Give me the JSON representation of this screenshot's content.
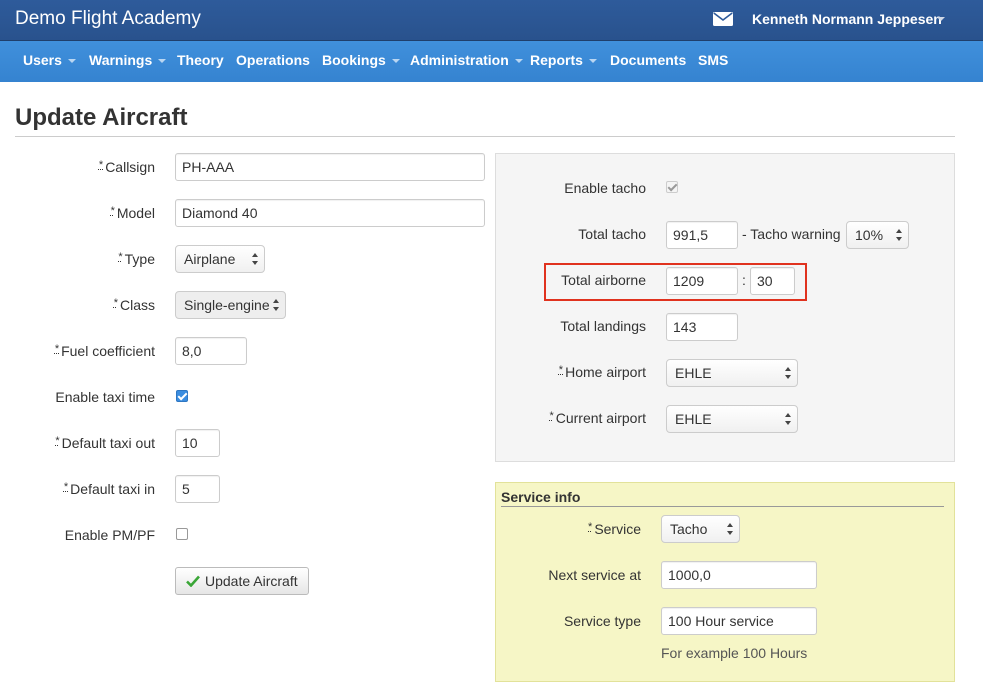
{
  "header": {
    "brand": "Demo Flight Academy",
    "user_name": "Kenneth Normann Jeppesen"
  },
  "nav": [
    {
      "label": "Users",
      "dropdown": true
    },
    {
      "label": "Warnings",
      "dropdown": true
    },
    {
      "label": "Theory",
      "dropdown": false
    },
    {
      "label": "Operations",
      "dropdown": false
    },
    {
      "label": "Bookings",
      "dropdown": true
    },
    {
      "label": "Administration",
      "dropdown": true
    },
    {
      "label": "Reports",
      "dropdown": true
    },
    {
      "label": "Documents",
      "dropdown": false
    },
    {
      "label": "SMS",
      "dropdown": false
    }
  ],
  "page_title": "Update Aircraft",
  "required_mark": "*",
  "left_form": {
    "callsign_label": "Callsign",
    "callsign_value": "PH-AAA",
    "model_label": "Model",
    "model_value": "Diamond 40",
    "type_label": "Type",
    "type_value": "Airplane",
    "class_label": "Class",
    "class_value": "Single-engine",
    "fuel_label": "Fuel coefficient",
    "fuel_value": "8,0",
    "taxi_time_label": "Enable taxi time",
    "taxi_time_checked": true,
    "taxi_out_label": "Default taxi out",
    "taxi_out_value": "10",
    "taxi_in_label": "Default taxi in",
    "taxi_in_value": "5",
    "pmpf_label": "Enable PM/PF",
    "pmpf_checked": false,
    "submit_label": "Update Aircraft"
  },
  "right_form": {
    "enable_tacho_label": "Enable tacho",
    "enable_tacho_checked": true,
    "total_tacho_label": "Total tacho",
    "total_tacho_value": "991,5",
    "tacho_warning_label": "- Tacho warning",
    "tacho_warning_value": "10%",
    "total_airborne_label": "Total airborne",
    "airborne_hours": "1209",
    "airborne_separator": ":",
    "airborne_minutes": "30",
    "total_landings_label": "Total landings",
    "total_landings_value": "143",
    "home_airport_label": "Home airport",
    "home_airport_value": "EHLE",
    "current_airport_label": "Current airport",
    "current_airport_value": "EHLE"
  },
  "service_info": {
    "title": "Service info",
    "service_label": "Service",
    "service_value": "Tacho",
    "next_service_label": "Next service at",
    "next_service_value": "1000,0",
    "service_type_label": "Service type",
    "service_type_value": "100 Hour service",
    "service_type_help": "For example 100 Hours"
  },
  "colors": {
    "topbar": "#2e5b9b",
    "navbar": "#3a8bd8",
    "highlight_border": "#e0321e",
    "service_panel": "#f6f6c6",
    "checkbox_checked": "#3b8de0",
    "check_icon": "#3aa637"
  }
}
